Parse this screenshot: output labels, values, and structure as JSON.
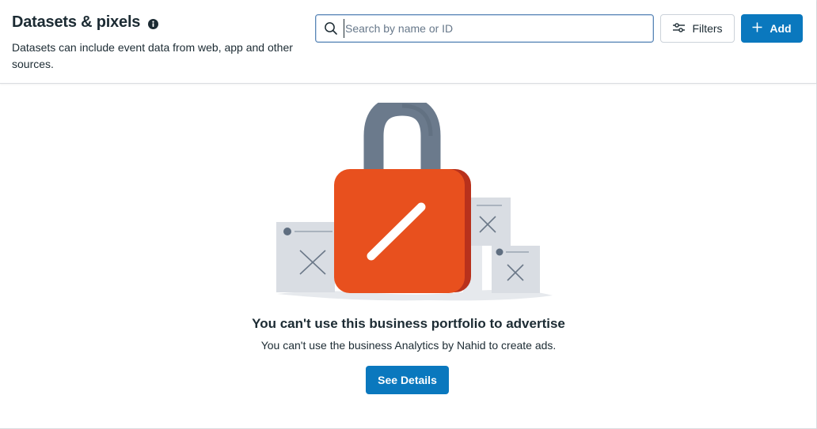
{
  "header": {
    "title": "Datasets & pixels",
    "info_icon": "info-icon",
    "description": "Datasets can include event data from web, app and other sources."
  },
  "search": {
    "placeholder": "Search by name or ID",
    "value": "",
    "icon": "search-icon"
  },
  "toolbar": {
    "filters_label": "Filters",
    "filters_icon": "sliders-icon",
    "add_label": "Add",
    "add_icon": "plus-icon"
  },
  "empty_state": {
    "illustration": "padlock-illustration",
    "title": "You can't use this business portfolio to advertise",
    "description": "You can't use the business Analytics by Nahid to create ads.",
    "button_label": "See Details"
  },
  "colors": {
    "accent": "#0a78be",
    "lock_body": "#e8501e",
    "lock_shackle": "#6b7a8c",
    "card": "#d9dde3"
  }
}
